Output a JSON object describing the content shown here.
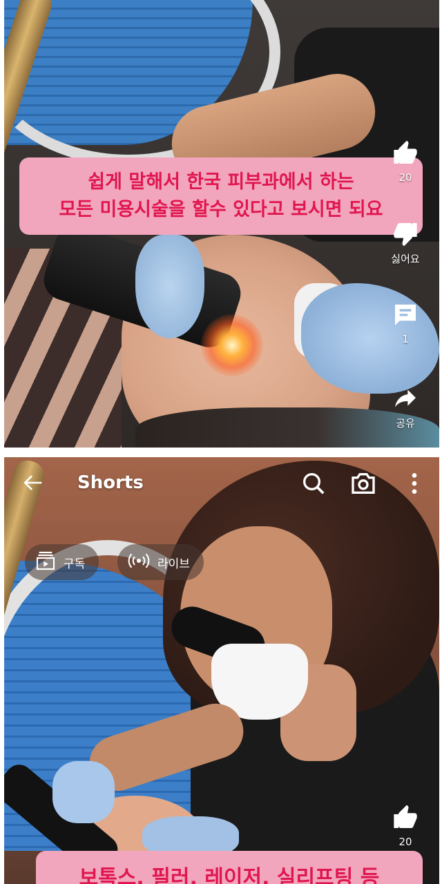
{
  "top_frame": {
    "caption_lines": [
      "쉽게 말해서 한국 피부과에서 하는",
      "모든 미용시술을 할수 있다고 보시면 되요"
    ],
    "actions": {
      "like_count": "20",
      "dislike_label": "싫어요",
      "comment_count": "1",
      "share_label": "공유"
    }
  },
  "bottom_frame": {
    "title": "Shorts",
    "chips": {
      "subscriptions": "구독",
      "live": "라이브"
    },
    "like_count": "20",
    "caption_partial": "보톡스, 필러, 레이저, 실리프팅 등"
  },
  "colors": {
    "caption_bg": "#f2a6bd",
    "caption_text": "#e0164f"
  },
  "icons": [
    "thumbs-up-icon",
    "thumbs-down-icon",
    "comment-icon",
    "share-icon",
    "back-arrow-icon",
    "search-icon",
    "camera-icon",
    "more-vert-icon",
    "subscriptions-icon",
    "live-icon"
  ]
}
